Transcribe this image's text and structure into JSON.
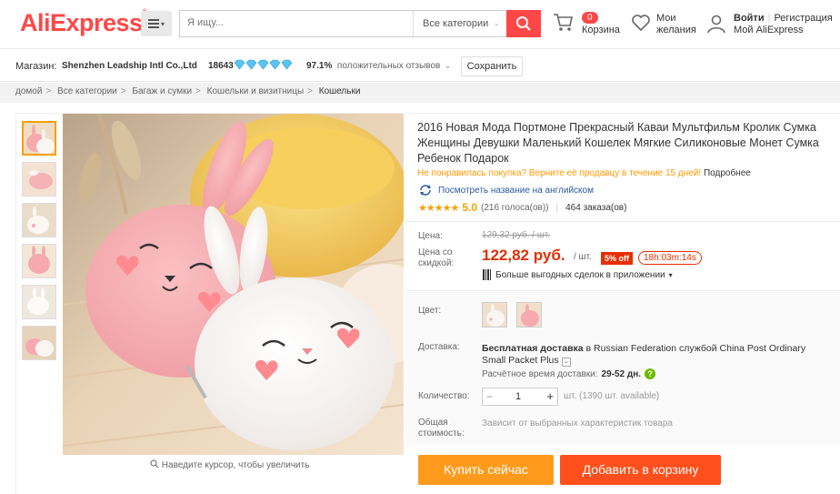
{
  "header": {
    "logo": "AliExpress",
    "logo_tm": "®",
    "search_placeholder": "Я ищу...",
    "category": "Все категории",
    "cart_count": "0",
    "cart_label": "Корзина",
    "wish_line1": "Мои",
    "wish_line2": "желания",
    "signin": "Войти",
    "register": "Регистрация",
    "my_ali": "Мой AliExpress"
  },
  "store": {
    "label": "Магазин:",
    "name": "Shenzhen Leadship Intl Co.,Ltd",
    "score": "18643",
    "positive_pct": "97.1%",
    "positive_label": "положительных отзывов",
    "save_label": "Сохранить"
  },
  "breadcrumb": [
    "домой",
    "Все категории",
    "Багаж и сумки",
    "Кошельки и визитницы",
    "Кошельки"
  ],
  "gallery": {
    "zoom_hint": "Наведите курсор, чтобы увеличить"
  },
  "product": {
    "title": "2016 Новая Мода Портмоне Прекрасный Каваи Мультфильм Кролик Сумка Женщины Девушки Маленький Кошелек Мягкие Силиконовые Монет Сумка Ребенок Подарок",
    "returns_text": "Не понравилась покупка? Верните её продавцу в течение 15 дней!",
    "returns_more": "Подробнее",
    "english_link": "Посмотреть название на английском",
    "rating_value": "5.0",
    "votes": "(216 голоса(ов))",
    "orders": "464 заказа(ов)"
  },
  "price": {
    "label": "Цена:",
    "old": "129,32 руб. / шт.",
    "discount_label_1": "Цена со",
    "discount_label_2": "скидкой:",
    "new": "122,82 руб.",
    "unit": "/ шт.",
    "off": "5% off",
    "timer": "18h:03m:14s",
    "app_deal": "Больше выгодных сделок в приложении"
  },
  "options": {
    "color_label": "Цвет:",
    "delivery_label": "Доставка:",
    "delivery_text_1": "Бесплатная доставка",
    "delivery_text_2": "в Russian Federation службой",
    "delivery_text_3": "China Post Ordinary Small Packet Plus",
    "delivery_time_label": "Расчётное время доставки:",
    "delivery_time": "29-52 дн.",
    "qty_label": "Количество:",
    "qty_value": "1",
    "qty_avail": "шт. (1390 шт. available)",
    "total_label_1": "Общая",
    "total_label_2": "стоимость:",
    "total_text": "Зависит от выбранных характеристик товара"
  },
  "actions": {
    "buy_now": "Купить сейчас",
    "add_to_cart": "Добавить в корзину"
  },
  "colors": {
    "brand": "#ff4747",
    "price": "#e62e04",
    "buy": "#ff9a1c",
    "cart": "#ff4f1c"
  }
}
